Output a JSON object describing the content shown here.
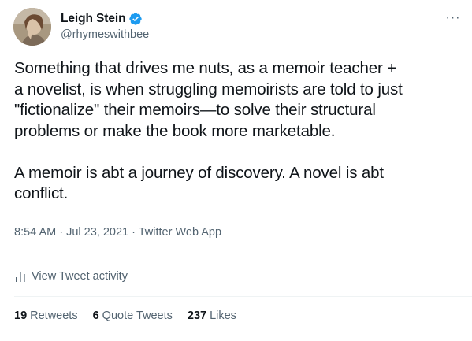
{
  "author": {
    "display_name": "Leigh Stein",
    "handle": "@rhymeswithbee",
    "verified": true
  },
  "more_menu": {
    "icon": "more-horizontal-icon",
    "label": "···"
  },
  "tweet": {
    "text": "Something that drives me nuts, as a memoir teacher +\na novelist, is when struggling memoirists are told to just\n\"fictionalize\" their memoirs—to solve their structural\nproblems or make the book more marketable.\n\nA memoir is abt a journey of discovery. A novel is abt\nconflict.",
    "time": "8:54 AM",
    "separator": "·",
    "date": "Jul 23, 2021",
    "source": "Twitter Web App"
  },
  "activity": {
    "icon": "bar-chart-icon",
    "label": "View Tweet activity"
  },
  "stats": {
    "retweets": {
      "count": "19",
      "label": "Retweets"
    },
    "quote_tweets": {
      "count": "6",
      "label": "Quote Tweets"
    },
    "likes": {
      "count": "237",
      "label": "Likes"
    }
  },
  "colors": {
    "text_primary": "#0f1419",
    "text_secondary": "#536471",
    "verified_blue": "#1d9bf0",
    "divider": "#eff3f4"
  }
}
